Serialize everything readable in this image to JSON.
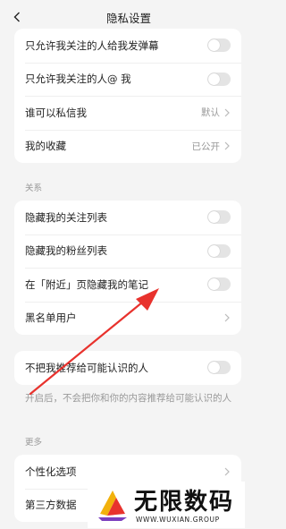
{
  "header": {
    "title": "隐私设置",
    "back_icon": "chevron-left-icon"
  },
  "card_top": {
    "rows": [
      {
        "label": "只允许我关注的人给我发弹幕",
        "toggle_on": false
      },
      {
        "label": "只允许我关注的人@ 我",
        "toggle_on": false
      },
      {
        "label": "谁可以私信我",
        "value": "默认"
      },
      {
        "label": "我的收藏",
        "value": "已公开"
      }
    ]
  },
  "section_relations": {
    "label": "关系"
  },
  "card_relations": {
    "rows": [
      {
        "label": "隐藏我的关注列表",
        "toggle_on": false
      },
      {
        "label": "隐藏我的粉丝列表",
        "toggle_on": false
      },
      {
        "label": "在「附近」页隐藏我的笔记",
        "toggle_on": false
      },
      {
        "label": "黑名单用户"
      }
    ]
  },
  "card_recommend": {
    "label": "不把我推荐给可能认识的人",
    "toggle_on": false,
    "description": "开启后，不会把你和你的内容推荐给可能认识的人"
  },
  "section_more": {
    "label": "更多"
  },
  "card_more": {
    "rows": [
      {
        "label": "个性化选项"
      },
      {
        "label": "第三方数据"
      }
    ]
  },
  "watermark": {
    "title": "无限数码",
    "subtitle": "WWW.WUXIAN.GROUP"
  },
  "colors": {
    "annotation_arrow": "#e8322d",
    "toggle_off": "#e4e4e4",
    "background": "#f4f4f4"
  }
}
